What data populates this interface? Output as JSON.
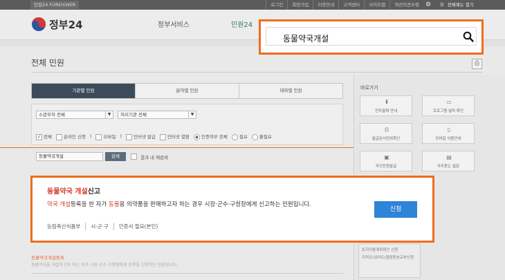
{
  "topbar": {
    "foreigner": "민원24 FOREIGNER",
    "links": [
      "로그인",
      "회원가입",
      "이용안내",
      "고객센터",
      "사이트맵",
      "개선의견수렴"
    ],
    "menu_label": "전체메뉴 열기"
  },
  "header": {
    "logo_text": "정부24",
    "nav": [
      "정부서비스",
      "민원24"
    ]
  },
  "search": {
    "value": "동물약국개설"
  },
  "page": {
    "title": "전체 민원"
  },
  "tabs": [
    "기관별 민원",
    "분야별 민원",
    "테마별 민원"
  ],
  "filters": {
    "ministry": "소관부처 전체",
    "agency": "처리기관 전체",
    "checks": [
      "전체",
      "온라인 신청",
      "모바일",
      "인터넷 발급",
      "인터넷 열람"
    ],
    "check_open": "(",
    "check_close": ")",
    "cert": [
      "인증여부 전체",
      "필요",
      "불필요"
    ],
    "keyword": "동물약국개설",
    "search_button": "검색",
    "within_results": "결과 내 재검색"
  },
  "sidebar": {
    "title": "바로가기",
    "buttons": [
      "전자결제 안내",
      "프로그램 설치 확인",
      "발급문서진위확인",
      "모바일 이용안내",
      "무인민원발급",
      "자주묻는 질문"
    ],
    "links": [
      "토지이용계획확인 신청",
      "지적도(임야도)열람등본교부신청"
    ]
  },
  "result": {
    "title_hl": "동물약국 개설",
    "title_rest": "신고",
    "desc_hl1": "약국 개설",
    "desc_mid": "등록을 한 자가 ",
    "desc_hl2": "동물",
    "desc_rest": "용 의약품을 판매하고자 하는 경우 시장·군수·구청장에게 신고하는 민원입니다.",
    "meta": [
      "농림축산식품부",
      "시·군·구",
      "인증서 필요(본인)"
    ],
    "apply_label": "신청"
  },
  "next_result": {
    "title": "동물약국개설등록",
    "desc": "동물약국을 개설하고자 하는 자가 시장·군수·구청장에게 등록을 신청하는 민원입니다."
  },
  "colors": {
    "highlight": "#ee6d1c",
    "apply": "#2e84d6",
    "keyword": "#d63a2a"
  }
}
